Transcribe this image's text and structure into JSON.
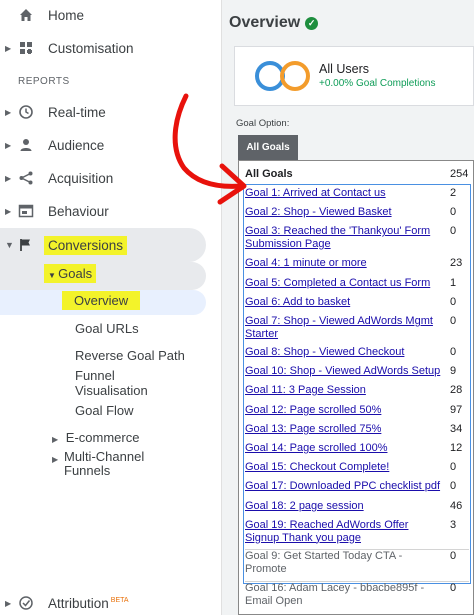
{
  "sidebar": {
    "home_label": "Home",
    "customisation_label": "Customisation",
    "reports_heading": "REPORTS",
    "realtime_label": "Real-time",
    "audience_label": "Audience",
    "acquisition_label": "Acquisition",
    "behaviour_label": "Behaviour",
    "conversions_label": "Conversions",
    "goals_label": "Goals",
    "overview_label": "Overview",
    "goal_urls_label": "Goal URLs",
    "reverse_goal_path_label": "Reverse Goal Path",
    "funnel_visualisation_label": "Funnel Visualisation",
    "goal_flow_label": "Goal Flow",
    "ecommerce_label": "E-commerce",
    "multichannel_label": "Multi-Channel Funnels",
    "attribution_label": "Attribution",
    "attribution_badge": "BETA"
  },
  "main": {
    "title": "Overview",
    "segment": {
      "name": "All Users",
      "subtitle": "+0.00% Goal Completions"
    },
    "goal_option_label": "Goal Option:",
    "tab_label": "All Goals",
    "goals": [
      {
        "name": "All Goals",
        "count": "254"
      },
      {
        "name": "Goal 1: Arrived at Contact us",
        "count": "2"
      },
      {
        "name": "Goal 2: Shop - Viewed Basket",
        "count": "0"
      },
      {
        "name": "Goal 3: Reached the 'Thankyou' Form Submission Page",
        "count": "0"
      },
      {
        "name": "Goal 4: 1 minute or more",
        "count": "23"
      },
      {
        "name": "Goal 5: Completed a Contact us Form",
        "count": "1"
      },
      {
        "name": "Goal 6: Add to basket",
        "count": "0"
      },
      {
        "name": "Goal 7: Shop - Viewed AdWords Mgmt Starter",
        "count": "0"
      },
      {
        "name": "Goal 8: Shop - Viewed Checkout",
        "count": "0"
      },
      {
        "name": "Goal 10: Shop - Viewed AdWords Setup",
        "count": "9"
      },
      {
        "name": "Goal 11: 3 Page Session",
        "count": "28"
      },
      {
        "name": "Goal 12: Page scrolled 50%",
        "count": "97"
      },
      {
        "name": "Goal 13: Page scrolled 75%",
        "count": "34"
      },
      {
        "name": "Goal 14: Page scrolled 100%",
        "count": "12"
      },
      {
        "name": "Goal 15: Checkout Complete!",
        "count": "0"
      },
      {
        "name": "Goal 17: Downloaded PPC checklist pdf",
        "count": "0"
      },
      {
        "name": "Goal 18: 2 page session",
        "count": "46"
      },
      {
        "name": "Goal 19: Reached AdWords Offer Signup Thank you page",
        "count": "3"
      },
      {
        "name": "Goal 9: Get Started Today CTA - Promote",
        "count": "0"
      },
      {
        "name": "Goal 16: Adam Lacey - bbacbe895f - Email Open",
        "count": "0"
      }
    ]
  },
  "colors": {
    "highlight": "#f3f32a",
    "annotation_arrow": "#e8120c",
    "goal_frame": "#4a90e2",
    "check": "#1e8e3e",
    "segment_orange": "#f39c2c",
    "segment_blue": "#3a8fd9"
  },
  "icons": [
    "home-icon",
    "customisation-icon",
    "clock-icon",
    "person-icon",
    "acquisition-icon",
    "behaviour-icon",
    "flag-icon",
    "check-icon"
  ]
}
